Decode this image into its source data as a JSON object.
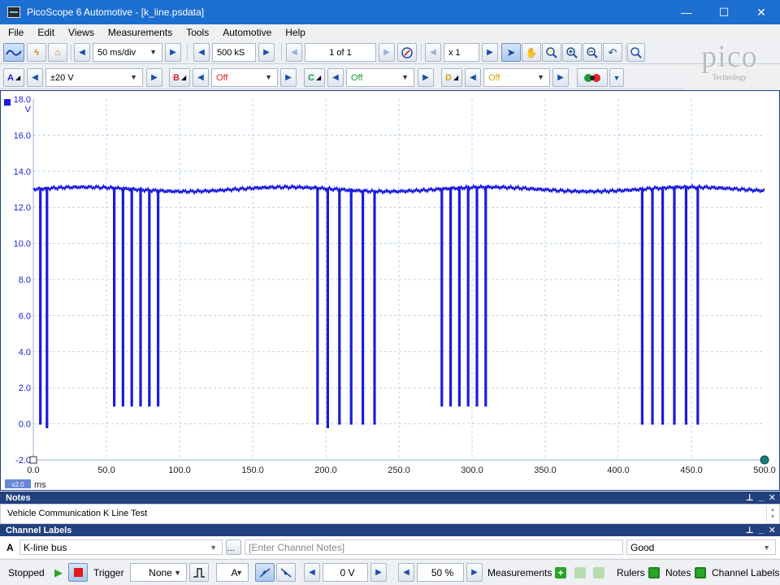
{
  "window": {
    "title": "PicoScope 6 Automotive - [k_line.psdata]",
    "minimize": "—",
    "maximize": "☐",
    "close": "✕"
  },
  "menu": [
    "File",
    "Edit",
    "Views",
    "Measurements",
    "Tools",
    "Automotive",
    "Help"
  ],
  "toolbar": {
    "timebase": "50 ms/div",
    "samples": "500 kS",
    "buffer": "1 of 1",
    "zoom": "x 1"
  },
  "channels": [
    {
      "letter": "A",
      "range": "±20 V",
      "color": "#1b1bdf"
    },
    {
      "letter": "B",
      "range": "Off",
      "color": "#e0242b"
    },
    {
      "letter": "C",
      "range": "Off",
      "color": "#1b9c3a"
    },
    {
      "letter": "D",
      "range": "Off",
      "color": "#d9a400"
    }
  ],
  "logo": {
    "word": "pico",
    "sub": "Technology"
  },
  "chart_data": {
    "type": "line",
    "series": [
      {
        "values": []
      }
    ],
    "ylabel": "V",
    "xlabel": "ms",
    "x_scale_badge": "x2.0",
    "xlim": [
      0,
      500
    ],
    "ylim": [
      -2,
      18
    ],
    "x_ticks": [
      "0.0",
      "50.0",
      "100.0",
      "150.0",
      "200.0",
      "250.0",
      "300.0",
      "350.0",
      "400.0",
      "450.0",
      "500.0"
    ],
    "y_ticks": [
      "18.0",
      "16.0",
      "14.0",
      "12.0",
      "10.0",
      "8.0",
      "6.0",
      "4.0",
      "2.0",
      "0.0",
      "-2.0"
    ],
    "grid": true,
    "baseline_v": 13.0,
    "pulses": [
      {
        "t": 4.5,
        "low": 0.0
      },
      {
        "t": 9.0,
        "low": -0.2
      },
      {
        "t": 55.0,
        "low": 1.0
      },
      {
        "t": 61.0,
        "low": 1.0
      },
      {
        "t": 67.0,
        "low": 1.0
      },
      {
        "t": 73.0,
        "low": 1.0
      },
      {
        "t": 79.0,
        "low": 1.0
      },
      {
        "t": 85.0,
        "low": 1.0
      },
      {
        "t": 194.0,
        "low": 0.0
      },
      {
        "t": 201.0,
        "low": -0.2
      },
      {
        "t": 209.0,
        "low": 0.0
      },
      {
        "t": 217.0,
        "low": 0.0
      },
      {
        "t": 225.0,
        "low": 0.0
      },
      {
        "t": 233.0,
        "low": 0.0
      },
      {
        "t": 279.0,
        "low": 1.0
      },
      {
        "t": 285.0,
        "low": 1.0
      },
      {
        "t": 291.0,
        "low": 1.0
      },
      {
        "t": 297.0,
        "low": 1.0
      },
      {
        "t": 303.0,
        "low": 1.0
      },
      {
        "t": 309.0,
        "low": 1.0
      },
      {
        "t": 416.0,
        "low": 0.0
      },
      {
        "t": 423.0,
        "low": 0.0
      },
      {
        "t": 430.0,
        "low": 0.0
      },
      {
        "t": 438.0,
        "low": 0.0
      },
      {
        "t": 446.0,
        "low": 0.0
      },
      {
        "t": 454.0,
        "low": 0.0
      }
    ]
  },
  "notes": {
    "header": "Notes",
    "text": "Vehicle Communication K Line Test"
  },
  "channel_labels": {
    "header": "Channel Labels",
    "channel": "A",
    "label": "K-line bus",
    "more": "...",
    "notes_placeholder": "[Enter Channel Notes]",
    "status": "Good"
  },
  "status": {
    "state": "Stopped",
    "trigger_label": "Trigger",
    "trigger_mode": "None",
    "trigger_channel": "A",
    "threshold": "0 V",
    "pretrigger": "50 %",
    "measurements": "Measurements",
    "rulers": "Rulers",
    "notes": "Notes",
    "channel_labels": "Channel Labels"
  }
}
